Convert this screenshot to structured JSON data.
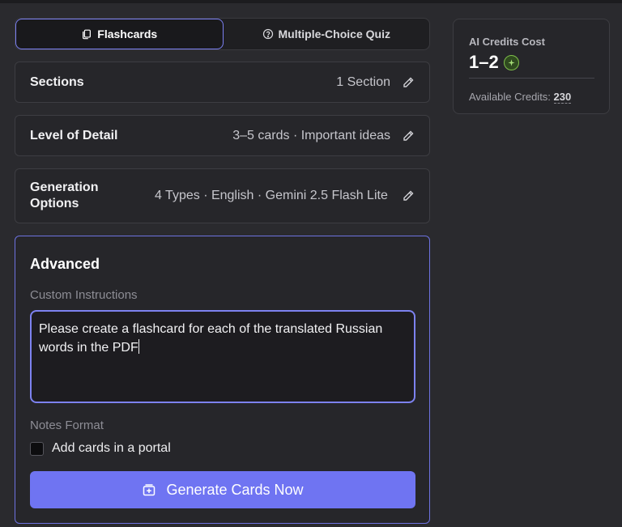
{
  "tabs": [
    {
      "label": "Flashcards",
      "icon": "cards-icon",
      "active": true
    },
    {
      "label": "Multiple-Choice Quiz",
      "icon": "question-circle-icon",
      "active": false
    }
  ],
  "settings": {
    "sections": {
      "label": "Sections",
      "value": "1 Section"
    },
    "detail": {
      "label": "Level of Detail",
      "value": "3–5 cards · Important ideas"
    },
    "generation": {
      "label": "Generation Options",
      "value": "4 Types · English · Gemini 2.5 Flash Lite"
    }
  },
  "advanced": {
    "title": "Advanced",
    "custom_label": "Custom Instructions",
    "custom_value": "Please create a flashcard for each of the translated Russian words in the PDF",
    "notes_label": "Notes Format",
    "checkbox_label": "Add cards in a portal",
    "checkbox_checked": false,
    "button_label": "Generate Cards Now"
  },
  "credits": {
    "title": "AI Credits Cost",
    "cost": "1–2",
    "available_label": "Available Credits:",
    "available_value": "230"
  },
  "colors": {
    "accent": "#6f74f2",
    "background": "#2a2a2e",
    "panel": "#26262a",
    "credit_badge": "#7fbf4a"
  }
}
